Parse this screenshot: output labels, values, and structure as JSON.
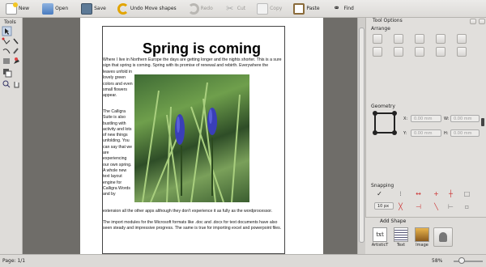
{
  "toolbar": {
    "items": [
      {
        "label": "New",
        "icon": "new-icon",
        "enabled": true
      },
      {
        "label": "Open",
        "icon": "open-icon",
        "enabled": true
      },
      {
        "label": "Save",
        "icon": "save-icon",
        "enabled": true
      },
      {
        "label": "Undo Move shapes",
        "icon": "undo-icon",
        "enabled": true
      },
      {
        "label": "Redo",
        "icon": "redo-icon",
        "enabled": false
      },
      {
        "label": "Cut",
        "icon": "cut-icon",
        "enabled": false
      },
      {
        "label": "Copy",
        "icon": "copy-icon",
        "enabled": false
      },
      {
        "label": "Paste",
        "icon": "paste-icon",
        "enabled": true
      },
      {
        "label": "Find",
        "icon": "find-icon",
        "enabled": true
      }
    ]
  },
  "tools": {
    "title": "Tools"
  },
  "document": {
    "title": "Spring is coming",
    "para1_intro": "Where I live in Northern Europe the days are getting longer and the nights shorter. This is a sure sign that spring is coming. Spring with its promise of renewal and rebirth. Everywhere the",
    "para1_left": "leaves unfold in lovely green colors and even small flowers appear.",
    "para2_left": "The Calligra Suite is also bustling with activity and lots of new things unfolding. You can say that we are experiencing our own spring. A whole new text layout engine for Calligra Words and by",
    "para2_end": "extension all the other apps although they don't experience it as fully as the wordprocessor.",
    "para3": "The import modules for the Microsoft formats like .doc and .docx for text documents have also seen steady and impressive progress. The same is true for importing excel and powerpoint files."
  },
  "tool_options": {
    "title": "Tool Options",
    "arrange_label": "Arrange",
    "geometry_label": "Geometry",
    "x_label": "X:",
    "y_label": "Y:",
    "w_label": "W:",
    "h_label": "H:",
    "x_value": "0.00 mm",
    "y_value": "0.00 mm",
    "w_value": "0.00 mm",
    "h_value": "0.00 mm",
    "snapping_label": "Snapping",
    "snap_distance": "10 px"
  },
  "add_shape": {
    "title": "Add Shape",
    "items": [
      {
        "label": "ArtisticT",
        "icon": "artistic-text-icon"
      },
      {
        "label": "Text",
        "icon": "text-shape-icon"
      },
      {
        "label": "Image",
        "icon": "image-shape-icon"
      }
    ]
  },
  "status": {
    "page": "Page: 1/1",
    "zoom": "58%"
  },
  "colors": {
    "accent": "#4a7cc0",
    "canvas": "#6f6d69",
    "panel": "#e1dfdc"
  }
}
